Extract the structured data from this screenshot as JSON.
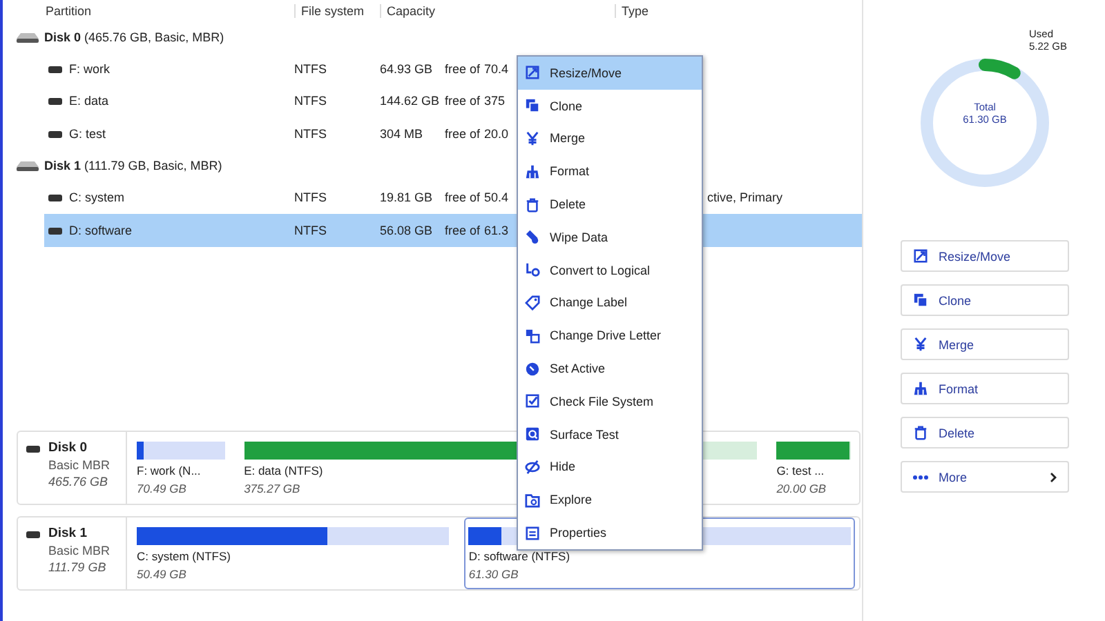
{
  "table": {
    "columns": [
      "Partition",
      "File system",
      "Capacity",
      "Type"
    ],
    "disks": [
      {
        "title": "**Disk 0** (465.76 GB, Basic, MBR)",
        "partitions": [
          {
            "name": "F: work",
            "fs": "NTFS",
            "free": "64.93 GB",
            "free_label": "free of",
            "total": "70.4",
            "selected": false
          },
          {
            "name": "E: data",
            "fs": "NTFS",
            "free": "144.62 GB",
            "free_label": "free of",
            "total": "375",
            "selected": false
          },
          {
            "name": "G: test",
            "fs": "NTFS",
            "free": "304 MB",
            "free_label": "free of",
            "total": "20.0",
            "selected": false
          }
        ]
      },
      {
        "title": "**Disk 1** (111.79 GB, Basic, MBR)",
        "partitions": [
          {
            "name": "C: system",
            "fs": "NTFS",
            "free": "19.81 GB",
            "free_label": "free of",
            "total": "50.4",
            "type": "ctive, Primary",
            "selected": false
          },
          {
            "name": "D: software",
            "fs": "NTFS",
            "free": "56.08 GB",
            "free_label": "free of",
            "total": "61.3",
            "selected": true
          }
        ]
      }
    ]
  },
  "context_menu": [
    {
      "label": "Resize/Move",
      "selected": true
    },
    {
      "label": "Clone",
      "selected": false
    },
    {
      "label": "Merge",
      "selected": false
    },
    {
      "label": "Format",
      "selected": false
    },
    {
      "label": "Delete",
      "selected": false
    },
    {
      "label": "Wipe Data",
      "selected": false
    },
    {
      "label": "Convert to Logical",
      "selected": false
    },
    {
      "label": "Change Label",
      "selected": false
    },
    {
      "label": "Change Drive Letter",
      "selected": false
    },
    {
      "label": "Set Active",
      "selected": false
    },
    {
      "label": "Check File System",
      "selected": false
    },
    {
      "label": "Surface Test",
      "selected": false
    },
    {
      "label": "Hide",
      "selected": false
    },
    {
      "label": "Explore",
      "selected": false
    },
    {
      "label": "Properties",
      "selected": false
    }
  ],
  "disk_map": [
    {
      "name": "Disk 0",
      "style": "Basic MBR",
      "size": "465.76 GB",
      "partitions": [
        {
          "label": "F: work (N...",
          "size": "70.49 GB",
          "level": 0.08,
          "color": "#1a4fe0",
          "selected": false
        },
        {
          "label": "E: data (NTFS)",
          "size": "375.27 GB",
          "level": 0.61,
          "color": "#20a040",
          "selected": false
        },
        {
          "label": "G: test ...",
          "size": "20.00 GB",
          "level": 0.98,
          "color": "#20a040",
          "selected": false
        }
      ]
    },
    {
      "name": "Disk 1",
      "style": "Basic MBR",
      "size": "111.79 GB",
      "partitions": [
        {
          "label": "C: system (NTFS)",
          "size": "50.49 GB",
          "level": 0.61,
          "color": "#1a4fe0",
          "selected": false
        },
        {
          "label": "D: software (NTFS)",
          "size": "61.30 GB",
          "level": 0.085,
          "color": "#1a4fe0",
          "selected": true
        }
      ]
    }
  ],
  "usage": {
    "used_label": "Used",
    "used": "5.22 GB",
    "level": 0.085,
    "total_label": "Total",
    "total": "61.30 GB"
  },
  "actions": [
    {
      "label": "Resize/Move",
      "kind": "action"
    },
    {
      "label": "Clone",
      "kind": "action"
    },
    {
      "label": "Merge",
      "kind": "action"
    },
    {
      "label": "Format",
      "kind": "action"
    },
    {
      "label": "Delete",
      "kind": "action"
    },
    {
      "label": "More",
      "kind": "more"
    }
  ]
}
